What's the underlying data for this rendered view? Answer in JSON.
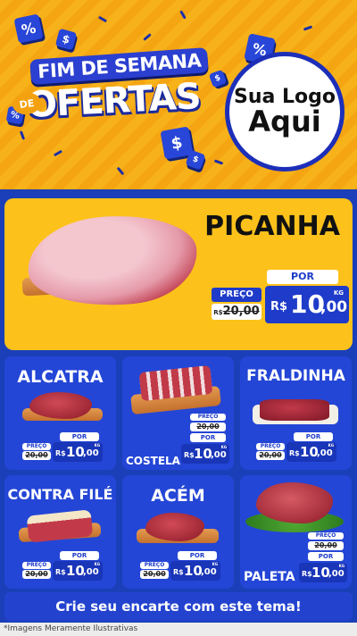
{
  "banner": {
    "title_line1": "FIM DE SEMANA",
    "title_de": "DE",
    "title_line2": "OFERTAS",
    "logo_line1": "Sua Logo",
    "logo_line2": "Aqui",
    "colors": {
      "background": "#f7b21a",
      "accent": "#2846d8"
    }
  },
  "labels": {
    "preco": "PREÇO",
    "por": "POR",
    "kg": "KG",
    "currency": "R$"
  },
  "featured": {
    "name": "PICANHA",
    "old_price": "20,00",
    "price_int": "10",
    "price_dec": ",00"
  },
  "products": [
    {
      "name": "ALCATRA",
      "old_price": "20,00",
      "price_int": "10",
      "price_dec": ",00"
    },
    {
      "name": "COSTELA",
      "old_price": "20,00",
      "price_int": "10",
      "price_dec": ",00"
    },
    {
      "name": "FRALDINHA",
      "old_price": "20,00",
      "price_int": "10",
      "price_dec": ",00"
    },
    {
      "name": "CONTRA FILÉ",
      "old_price": "20,00",
      "price_int": "10",
      "price_dec": ",00"
    },
    {
      "name": "ACÉM",
      "old_price": "20,00",
      "price_int": "10",
      "price_dec": ",00"
    },
    {
      "name": "PALETA",
      "old_price": "20,00",
      "price_int": "10",
      "price_dec": ",00"
    }
  ],
  "footer": {
    "cta": "Crie seu encarte com este tema!",
    "disclaimer": "*Imagens Meramente Ilustrativas"
  }
}
